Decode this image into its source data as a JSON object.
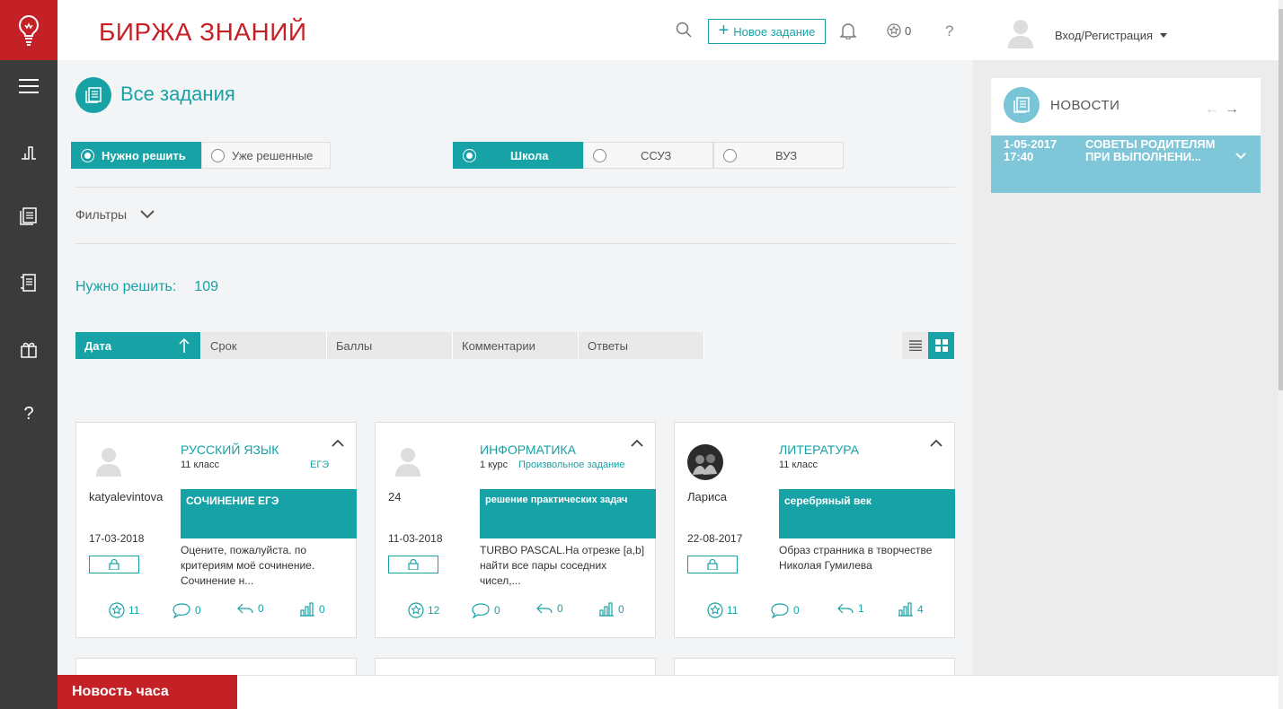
{
  "header": {
    "brand": "БИРЖА ЗНАНИЙ",
    "new_task_label": "Новое задание",
    "stars_count": "0",
    "help": "?",
    "login_label": "Вход/Регистрация"
  },
  "sidebar": {
    "items": [
      "menu-icon",
      "chart-icon",
      "tasks-icon",
      "document-icon",
      "gift-icon",
      "help-icon"
    ],
    "help_glyph": "?"
  },
  "page": {
    "title": "Все задания",
    "status_tabs": [
      {
        "label": "Нужно решить",
        "active": true
      },
      {
        "label": "Уже решенные",
        "active": false
      }
    ],
    "level_tabs": [
      {
        "label": "Школа",
        "active": true
      },
      {
        "label": "ССУЗ",
        "active": false
      },
      {
        "label": "ВУЗ",
        "active": false
      }
    ],
    "filters_label": "Фильтры",
    "count_label": "Нужно решить:",
    "count_value": "109",
    "sort": [
      "Дата",
      "Срок",
      "Баллы",
      "Комментарии",
      "Ответы"
    ]
  },
  "cards": [
    {
      "subject": "РУССКИЙ ЯЗЫК",
      "grade": "11 класс",
      "type": "ЕГЭ",
      "user": "katyalevintova",
      "date": "17-03-2018",
      "banner": "СОЧИНЕНИЕ ЕГЭ",
      "desc": "Оцените, пожалуйста. по критериям моё сочинение. Сочинение н...",
      "stars": "11",
      "comments": "0",
      "answers": "0",
      "views": "0"
    },
    {
      "subject": "ИНФОРМАТИКА",
      "grade": "1 курс",
      "type": "Произвольное задание",
      "user": "24",
      "date": "11-03-2018",
      "banner": "решение практических задач",
      "desc": "TURBO PASCAL.На отрезке [a,b] найти все пары соседних чисел,...",
      "stars": "12",
      "comments": "0",
      "answers": "0",
      "views": "0"
    },
    {
      "subject": "ЛИТЕРАТУРА",
      "grade": "11 класс",
      "type": "",
      "user": "Лариса",
      "date": "22-08-2017",
      "banner": "серебряный век",
      "desc": "Образ странника в творчестве Николая Гумилева",
      "stars": "11",
      "comments": "0",
      "answers": "1",
      "views": "4"
    }
  ],
  "news": {
    "title": "НОВОСТИ",
    "item_date": "1-05-2017",
    "item_time": "17:40",
    "item_text": "Советы родителям при выполнени..."
  },
  "footer": {
    "news_hour": "Новость часа"
  },
  "colors": {
    "accent": "#17a2a6",
    "brand_red": "#c42127",
    "sidebar": "#3b3b3b",
    "news_item": "#7ec6d8"
  }
}
